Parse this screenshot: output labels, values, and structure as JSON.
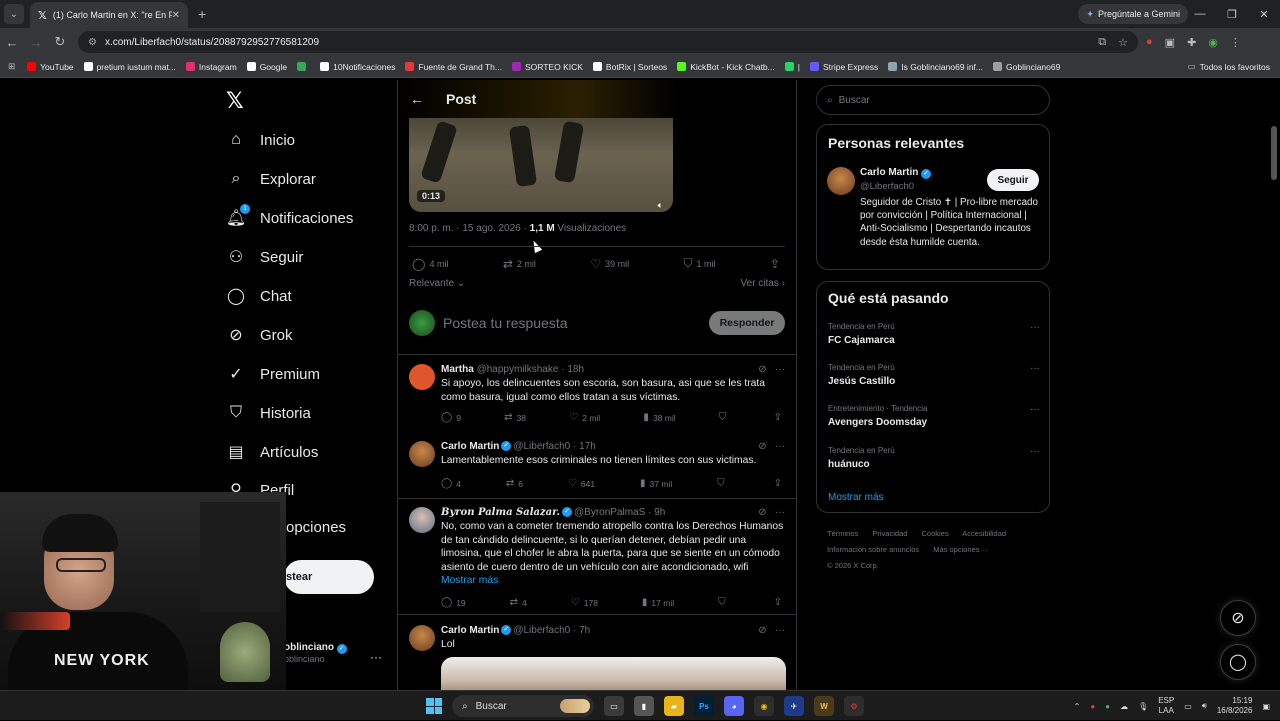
{
  "browser": {
    "tab_title": "(1) Carlo Martin en X: \"re En Pe",
    "gemini_label": "Pregúntale a Gemini",
    "url": "x.com/Liberfach0/status/2088792952776581209",
    "bookmarks": [
      {
        "label": "YouTube",
        "color": "#ff0000"
      },
      {
        "label": "pretium iustum mat...",
        "color": "#ffffff"
      },
      {
        "label": "Instagram",
        "color": "#e1306c"
      },
      {
        "label": "Google",
        "color": "#ffffff"
      },
      {
        "label": "",
        "color": "#34a853"
      },
      {
        "label": "10Notificaciones",
        "color": "#ffffff"
      },
      {
        "label": "Fuente de Grand Th...",
        "color": "#e53935"
      },
      {
        "label": "SORTEO KICK",
        "color": "#9c27b0"
      },
      {
        "label": "BotRix | Sorteos",
        "color": "#ffffff"
      },
      {
        "label": "KickBot - Kick Chatb...",
        "color": "#53fc18"
      },
      {
        "label": "|",
        "color": "#25d366"
      },
      {
        "label": "Stripe Express",
        "color": "#635bff"
      },
      {
        "label": "Is Goblinciano69 inf...",
        "color": "#90a4ae"
      },
      {
        "label": "Goblinciano69",
        "color": "#9e9e9e"
      }
    ],
    "bookmarks_all": "Todos los favoritos"
  },
  "nav": {
    "items": [
      {
        "label": "Inicio"
      },
      {
        "label": "Explorar"
      },
      {
        "label": "Notificaciones",
        "badge": "1"
      },
      {
        "label": "Seguir"
      },
      {
        "label": "Chat"
      },
      {
        "label": "Grok"
      },
      {
        "label": "Premium"
      },
      {
        "label": "Historia"
      },
      {
        "label": "Artículos"
      },
      {
        "label": "Perfil"
      },
      {
        "label": "opciones"
      }
    ],
    "post_button": "stear",
    "profile_name": "oblinciano",
    "profile_handle": "oblinciano"
  },
  "post": {
    "header": "Post",
    "video_time": "0:13",
    "timestamp": "8:00 p. m. · 15 ago. 2026 · ",
    "views_count": "1,1 M",
    "views_label": " Visualizaciones",
    "replies": "4 mil",
    "reposts": "2 mil",
    "likes": "39 mil",
    "bookmarks": "1 mil",
    "sort_label": "Relevante",
    "quotes_label": "Ver citas",
    "reply_placeholder": "Postea tu respuesta",
    "reply_button": "Responder"
  },
  "replies": [
    {
      "name": "Martha",
      "handle": "@happymilkshake · 18h",
      "text": "Si apoyo, los delincuentes son escoria, son basura, asi que se les trata como basura, igual como ellos tratan a sus víctimas.",
      "replies": "9",
      "reposts": "38",
      "likes": "2 mil",
      "views": "38 mil",
      "avatar_color": "#e0552b"
    },
    {
      "name": "Carlo Martin",
      "handle": "@Liberfach0 · 17h",
      "text": "Lamentablemente esos criminales no tienen límites con sus victimas.",
      "replies": "4",
      "reposts": "6",
      "likes": "641",
      "views": "37 mil",
      "avatar_color": "#a0603a"
    },
    {
      "name": "Byron Palma Salazar.",
      "handle": "@ByronPalmaS · 9h",
      "text": "No, como van a cometer tremendo atropello contra los Derechos Humanos de tan cándido delincuente, si lo querían detener, debían pedir una limosina, que el chofer le abra la puerta, para que se siente en un cómodo asiento de cuero dentro de un vehículo con aire acondicionado, wifi",
      "more": "Mostrar más",
      "replies": "19",
      "reposts": "4",
      "likes": "178",
      "views": "17 mil",
      "avatar_color": "#8aa0c0"
    },
    {
      "name": "Carlo Martin",
      "handle": "@Liberfach0 · 7h",
      "text": "Lol",
      "avatar_color": "#a0603a"
    }
  ],
  "sidebar": {
    "search_placeholder": "Buscar",
    "relevant_title": "Personas relevantes",
    "relevant_name": "Carlo Martin",
    "relevant_handle": "@Liberfach0",
    "follow_label": "Seguir",
    "relevant_bio": "Seguidor de Cristo ✝ | Pro-libre mercado por convicción | Política Internacional | Anti-Socialismo | Despertando incautos desde ésta humilde cuenta.",
    "trends_title": "Qué está pasando",
    "trends": [
      {
        "context": "Tendencia en Perú",
        "name": "FC Cajamarca"
      },
      {
        "context": "Tendencia en Perú",
        "name": "Jesús Castillo"
      },
      {
        "context": "Entretenimiento · Tendencia",
        "name": "Avengers Doomsday"
      },
      {
        "context": "Tendencia en Perú",
        "name": "huánuco"
      }
    ],
    "show_more": "Mostrar más",
    "footer_links": [
      "Términos",
      "Privacidad",
      "Cookies",
      "Accesibilidad",
      "Información sobre anuncios",
      "Más opciones ···"
    ],
    "copyright": "© 2026 X Corp."
  },
  "webcam": {
    "shirt_text": "NEW YORK"
  },
  "taskbar": {
    "search_label": "Buscar",
    "lang_top": "ESP",
    "lang_bottom": "LAA",
    "time": "15:19",
    "date": "16/8/2026"
  }
}
